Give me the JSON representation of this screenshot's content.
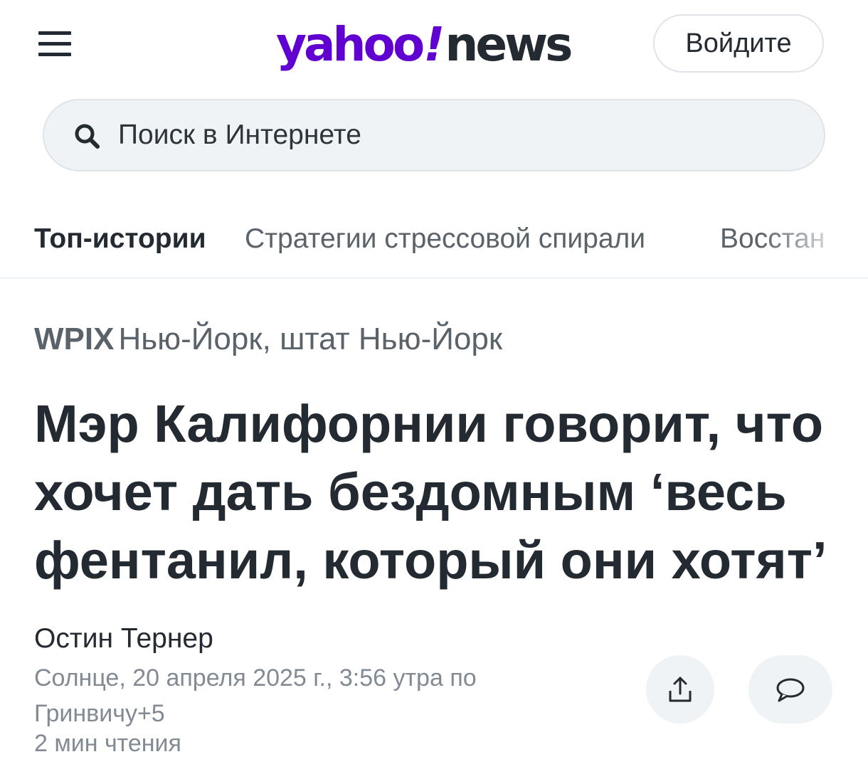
{
  "header": {
    "menu_icon": "hamburger-menu-icon",
    "logo_yahoo": "yahoo",
    "logo_bang": "!",
    "logo_news": "news",
    "signin_label": "Войдите"
  },
  "search": {
    "placeholder": "Поиск в Интернете",
    "icon": "search-icon"
  },
  "nav": {
    "tabs": [
      {
        "label": "Топ-истории",
        "active": true
      },
      {
        "label": "Стратегии стрессовой спирали",
        "active": false
      },
      {
        "label": "Восстан",
        "active": false
      }
    ]
  },
  "article": {
    "provider": "WPIX",
    "location": "Нью-Йорк, штат Нью-Йорк",
    "headline": "Мэр Калифорнии говорит, что хочет дать бездомным ‘весь фентанил, который они хотят’",
    "author": "Остин Тернер",
    "date": "Солнце, 20 апреля 2025 г., 3:56 утра по Гринвичу+5",
    "read_time": "2 мин чтения",
    "share_icon": "share-icon",
    "comment_icon": "comment-icon"
  },
  "colors": {
    "brand_purple": "#6001d2",
    "text_dark": "#232a31",
    "text_gray": "#5b636a",
    "text_light": "#828a93",
    "bg_gray": "#f0f3f5"
  }
}
